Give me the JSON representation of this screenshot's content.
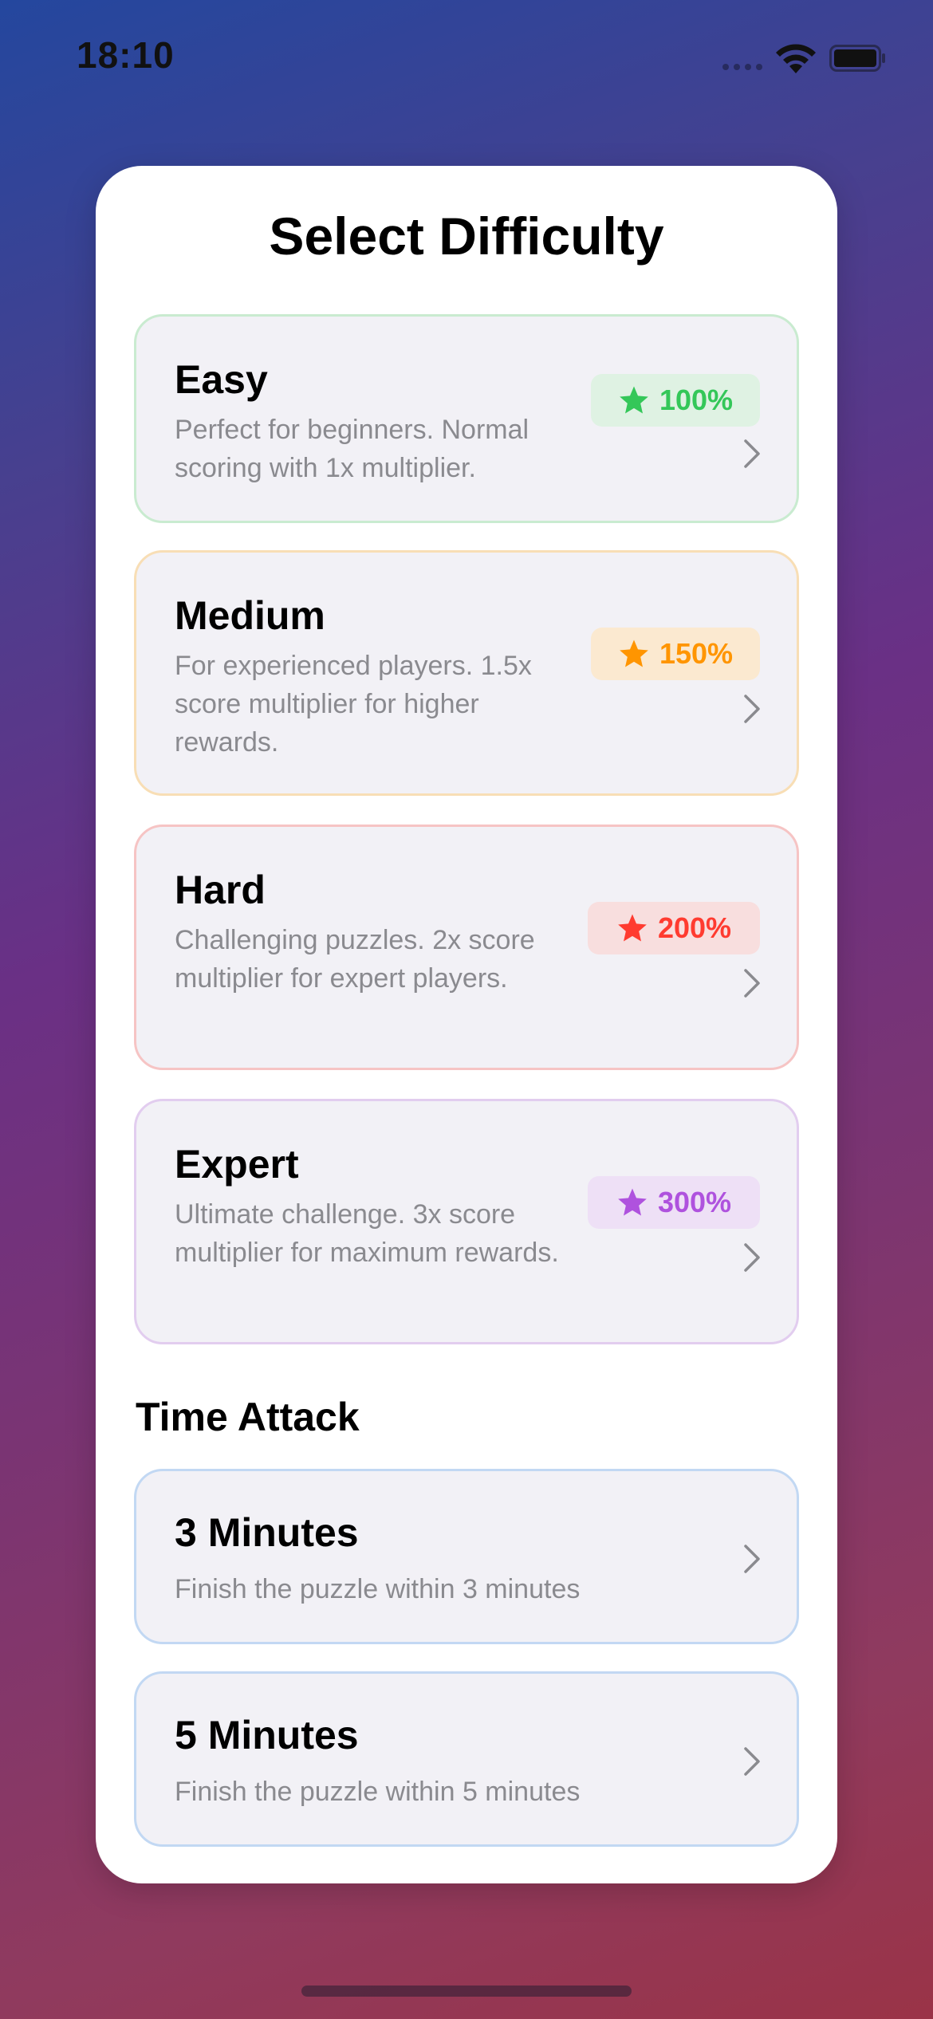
{
  "status_bar": {
    "time": "18:10"
  },
  "title": "Select Difficulty",
  "difficulties": [
    {
      "name": "Easy",
      "description": "Perfect for beginners. Normal scoring with 1x multiplier.",
      "badge": "100%",
      "color": "#34c759",
      "icon": "star-icon"
    },
    {
      "name": "Medium",
      "description": "For experienced players. 1.5x score multiplier for higher rewards.",
      "badge": "150%",
      "color": "#ff9500",
      "icon": "star-icon"
    },
    {
      "name": "Hard",
      "description": "Challenging puzzles. 2x score multiplier for expert players.",
      "badge": "200%",
      "color": "#ff3b30",
      "icon": "star-icon"
    },
    {
      "name": "Expert",
      "description": "Ultimate challenge. 3x score multiplier for maximum rewards.",
      "badge": "300%",
      "color": "#af52de",
      "icon": "star-icon"
    }
  ],
  "time_attack": {
    "section_title": "Time Attack",
    "options": [
      {
        "name": "3 Minutes",
        "description": "Finish the puzzle within 3 minutes"
      },
      {
        "name": "5 Minutes",
        "description": "Finish the puzzle within 5 minutes"
      }
    ]
  }
}
